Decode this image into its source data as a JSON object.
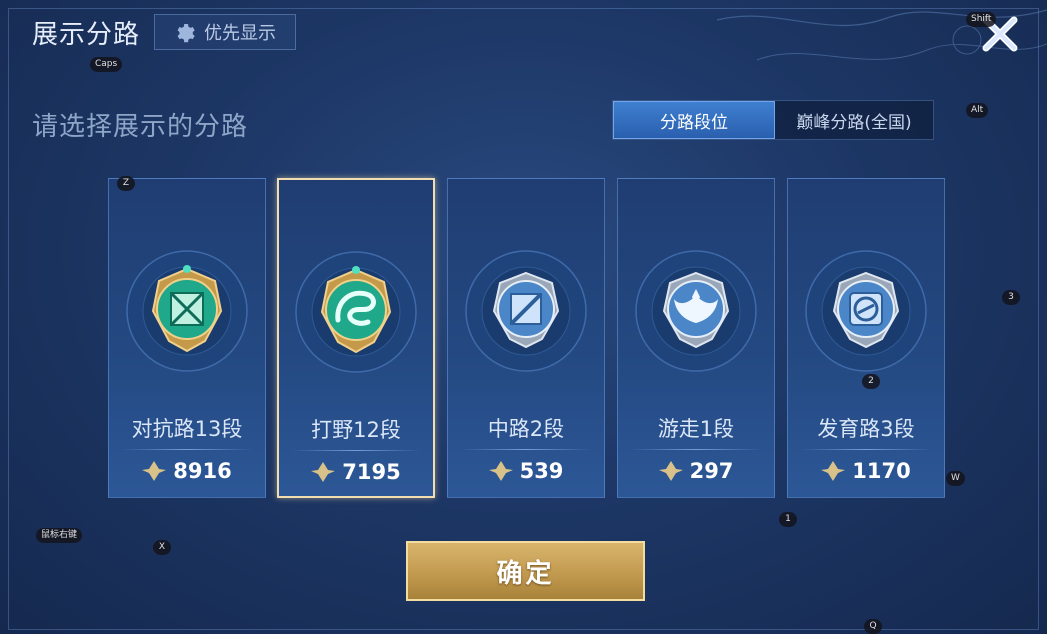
{
  "header": {
    "title": "展示分路",
    "priority_label": "优先显示"
  },
  "subtitle": "请选择展示的分路",
  "tabs": [
    {
      "label": "分路段位",
      "active": true
    },
    {
      "label": "巅峰分路(全国)",
      "active": false
    }
  ],
  "lanes": [
    {
      "name": "对抗路13段",
      "score": "8916",
      "selected": false,
      "emblem": "clash-lane-emblem-icon",
      "tier": "jade"
    },
    {
      "name": "打野12段",
      "score": "7195",
      "selected": true,
      "emblem": "jungle-dragon-emblem-icon",
      "tier": "jade"
    },
    {
      "name": "中路2段",
      "score": "539",
      "selected": false,
      "emblem": "mid-lane-emblem-icon",
      "tier": "silver"
    },
    {
      "name": "游走1段",
      "score": "297",
      "selected": false,
      "emblem": "roam-wings-emblem-icon",
      "tier": "silver"
    },
    {
      "name": "发育路3段",
      "score": "1170",
      "selected": false,
      "emblem": "farm-lane-emblem-icon",
      "tier": "silver"
    }
  ],
  "confirm_label": "确定",
  "key_hints": {
    "caps": "Caps",
    "shift": "Shift",
    "alt": "Alt",
    "z": "Z",
    "three": "3",
    "two": "2",
    "w": "W",
    "one": "1",
    "mouse_right": "鼠标右键",
    "x": "X",
    "q": "Q"
  },
  "colors": {
    "panel_bg": "#1d3766",
    "tab_active": "#3f7fd0",
    "selected_border": "#f1ddb0",
    "confirm_gold": "#c29a4f"
  }
}
